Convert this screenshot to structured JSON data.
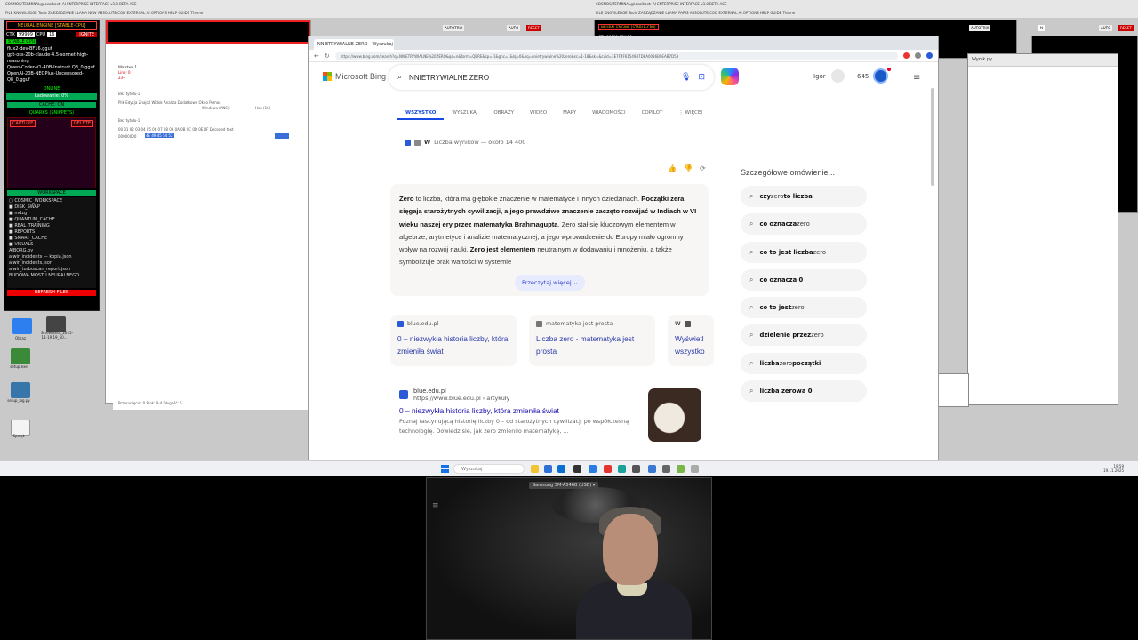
{
  "top_titles": {
    "left": "COSMOS/TERMINAL@localhost: AI ENTERPRISE INTERFACE v3.0 BETA ACE",
    "right": "COSMOS/TERMINAL@localhost: AI ENTERPRISE INTERFACE v3.0 BETA ACE"
  },
  "top_menu": {
    "left": "FILE   KNOWLEDGE   Tools   ZARZĄDZANIE   LLAMA   NEW   ABSOLUTE/COD   EXTERNAL AI   OPTIONS   HELP   GUIDE   Theme",
    "right": "FILE   KNOWLEDGE   Tools   ZARZĄDZANIE   LLAMA   PARIS   ABSOLUTE/COD   EXTERNAL AI   OPTIONS   HELP   GUIDE   Theme"
  },
  "neural": {
    "header": "NEURAL ENGINE [STABLE-CPU]",
    "ctx_label": "CTX",
    "ctx_value": "99999",
    "cpu_label": "CPU",
    "cpu_value": "16",
    "ignite": "IGNITE",
    "stable_tag": "STABLE CPU",
    "models": [
      "flux2-dev-BF16.gguf",
      "gpt-oss-20b-claude-4.5-sonnet-high-reasoning",
      "Qwen-Coder-V1-40B-Instruct.Q8_0.gguf",
      "OpenAI-20B-NEOPlus-Uncensored-Q8_0.gguf"
    ],
    "status": "ONLINE",
    "loading": "Ładowanie: 0%",
    "cache": "CACHE: ON",
    "quarks": "QUARKS (SNIPPETS)",
    "capture": "CAPTURE",
    "delete": "DELETE",
    "workspace": "WORKSPACE",
    "tree": [
      "▢ COSMIC_WORKSPACE",
      "  ■ DISK_SWAP",
      "  ■ mdzg",
      "  ■ QUANTUM_CACHE",
      "  ■ REAL_TRAINING",
      "  ■ REPORTS",
      "  ■ SMART_CACHE",
      "  ■ VISUALS",
      "    AIBORG.py",
      "    aiwir_incidents — kopia.json",
      "    aiwir_incidents.json",
      "    aiwir_turboscan_report.json",
      "    BUDOWA MOSTU NEURALNEGO..."
    ],
    "refresh": "REFRESH FILES"
  },
  "hexeditor": {
    "title": "Warstwa 1",
    "lines": [
      "Line: 0",
      "23+"
    ],
    "column_header": "00 01 02 03 04 05 06 07 08 09 0A 0B 0C 0D 0E 0F   Decoded text",
    "row_offset": "00000000",
    "row_selected": "4E 49 45 54 52",
    "menu": "Plik  Edycja  Znajdź  Widok  Analiza  Dodatkowe  Okno  Pomoc",
    "encoding": "Windows (ANSI)",
    "format": "Hex (16)",
    "file": "Bez tytułu-1",
    "status": "Przesunięcie: 0        Blok: 0-4        Długość: 5"
  },
  "desktop_icons": [
    {
      "label": "Obraz"
    },
    {
      "label": "Screenshot_2025-11-19 19_50..."
    },
    {
      "label": "setup.exe"
    },
    {
      "label": "setup_log.py"
    },
    {
      "label": "Sprzęt"
    }
  ],
  "right_windows": {
    "title": "COSMOS/TERMINAL@localhost: AI ENTERPRISE INTERFACE v3.0 BETA ACE",
    "neural_header": "NEURAL ENGINE [STABLE-CPU]",
    "autotrx_a": "AUTOTRIX",
    "auto_a": "AUTO",
    "reset_a": "RESET",
    "autotrx_b": "AUTOTRIX",
    "auto_b": "AUTO",
    "reset_b": "RESET",
    "ctx_note": "CTX 99999 CPU 16",
    "file_tab": "Wynik.py",
    "side_note": "ngs or remain sil",
    "n_value": "N"
  },
  "browser": {
    "tab_title": "NNIETRYWIALNE ZERO - Wyszukaj",
    "url": "https://www.bing.com/search?q=NNIETRYWIALNE%20ZERO&qs=n&form=QBRE&sp=-1&ghc=1&lq=0&pq=nnietrywialne%20zero&sc=1-18&sk=&cvid=3E7F4F6154947D8A0036B9EAB7D53",
    "logo": "Microsoft Bing",
    "query": "NNIETRYWIALNE ZERO",
    "user": "Igor",
    "points": "645",
    "scopes": [
      "WSZYSTKO",
      "WYSZUKAJ",
      "OBRAZY",
      "WIDEO",
      "MAPY",
      "WIADOMOŚCI",
      "COPILOT",
      "⋮ WIĘCEJ"
    ],
    "results_count": "Liczba wyników — około 14 400",
    "answer": {
      "s1_b": "Zero",
      "s1": " to liczba, która ma głębokie znaczenie w matematyce i innych dziedzinach.",
      "s2_b": "Początki zera sięgają starożytnych cywilizacji, a jego prawdziwe znaczenie zaczęto rozwijać w Indiach w VI wieku naszej ery przez matematyka Brahmagupta",
      "s3": ". Zero stał się kluczowym elementem w algebrze, arytmetyce i analizie matematycznej, a jego wprowadzenie do Europy miało ogromny wpływ na rozwój nauki. ",
      "s4_b": "Zero jest elementem",
      "s4": " neutralnym w dodawaniu i mnożeniu, a także symbolizuje brak wartości w systemie"
    },
    "readmore": "Przeczytaj więcej ⌄",
    "cards": [
      {
        "source": "blue.edu.pl",
        "title": "0 – niezwykła historia liczby, która zmieniła świat"
      },
      {
        "source": "matematyka jest prosta",
        "title": "Liczba zero - matematyka jest prosta"
      },
      {
        "source": "",
        "title": "Wyświetl wszystko"
      }
    ],
    "result": {
      "site": "blue.edu.pl",
      "url": "https://www.blue.edu.pl › artykuły",
      "title": "0 – niezwykła historia liczby, która zmieniła świat",
      "snippet": "Poznaj fascynującą historię liczby 0 – od starożytnych cywilizacji po współczesną technologię. Dowiedz się, jak zero zmieniło matematykę, ..."
    },
    "related_title": "Szczegółowe omówienie...",
    "related": [
      {
        "b1": "czy",
        "n": " zero ",
        "b2": "to liczba"
      },
      {
        "b1": "co oznacza",
        "n": " zero",
        "b2": ""
      },
      {
        "b1": "co to jest liczba",
        "n": " zero",
        "b2": ""
      },
      {
        "b1": "co oznacza 0",
        "n": "",
        "b2": ""
      },
      {
        "b1": "co to jest",
        "n": " zero",
        "b2": ""
      },
      {
        "b1": "dzielenie przez",
        "n": " zero",
        "b2": ""
      },
      {
        "b1": "liczba",
        "n": " zero ",
        "b2": "początki"
      },
      {
        "b1": "liczba zerowa 0",
        "n": "",
        "b2": ""
      }
    ]
  },
  "taskbar": {
    "search": "Wyszukaj",
    "time": "19:59",
    "date": "19.11.2025"
  },
  "webcam": {
    "label": "Samsung SM-A546B (USB) ▾"
  },
  "colors": {
    "bing_blue": "#174ae4",
    "link": "#1a0dab",
    "accent_red": "#e22222"
  }
}
